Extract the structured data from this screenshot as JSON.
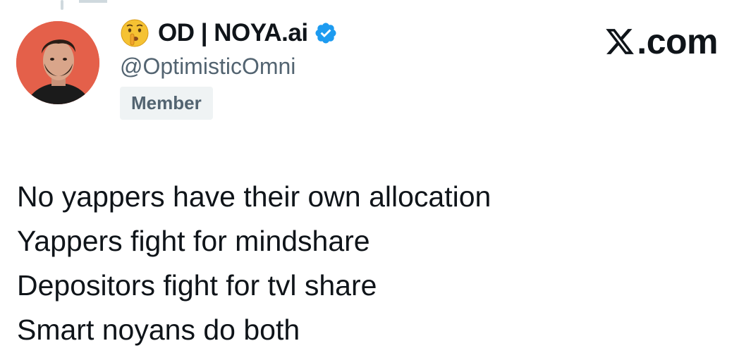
{
  "author": {
    "display_name": "OD | NOYA.ai",
    "handle": "@OptimisticOmni",
    "badge": "Member",
    "verified": true,
    "emoji": "shushing-face-icon",
    "avatar_bg": "#e4604a"
  },
  "brand": {
    "label": ".com",
    "logo": "x-logo-icon"
  },
  "tweet": {
    "lines": [
      "No yappers have their own allocation",
      "Yappers fight for mindshare",
      "Depositors fight for tvl share",
      "Smart noyans do both"
    ]
  },
  "colors": {
    "text": "#0f1419",
    "secondary": "#536471",
    "verified": "#1d9bf0",
    "badge_bg": "#eff3f4"
  }
}
